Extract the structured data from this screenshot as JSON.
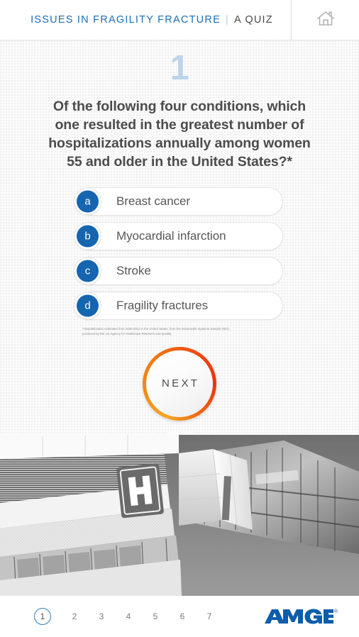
{
  "header": {
    "title_main": "ISSUES IN FRAGILITY FRACTURE",
    "separator": "|",
    "title_sub": "A QUIZ",
    "home_icon": "home-icon"
  },
  "quiz": {
    "number": "1",
    "question": "Of the following four conditions, which one resulted in the greatest number of hospitalizations annually among women 55 and older in the United States?*",
    "options": [
      {
        "letter": "a",
        "label": "Breast cancer"
      },
      {
        "letter": "b",
        "label": "Myocardial infarction"
      },
      {
        "letter": "c",
        "label": "Stroke"
      },
      {
        "letter": "d",
        "label": "Fragility fractures"
      }
    ],
    "footnote_line1": "*Hospitalization estimates from 2000-2011 in the United States, from the Nationwide Inpatient Sample (NIS),",
    "footnote_line2": "produced by the US Agency for Healthcare Research and Quality.",
    "next_label": "NEXT"
  },
  "photo": {
    "description": "Grayscale photograph of a modern hospital building exterior with a large H sign",
    "sign_letter": "H"
  },
  "footer": {
    "pages": [
      "1",
      "2",
      "3",
      "4",
      "5",
      "6",
      "7"
    ],
    "active_page": "1",
    "brand": "AMGEN",
    "brand_mark": "®"
  },
  "colors": {
    "brand_blue": "#0c5dab",
    "header_blue": "#1b6fb5",
    "badge_blue": "#1565b0",
    "page_active_blue": "#2a7fc1",
    "number_blue": "#bdd4ea",
    "ring_orange": "#f5a623",
    "ring_red": "#e8340e"
  }
}
